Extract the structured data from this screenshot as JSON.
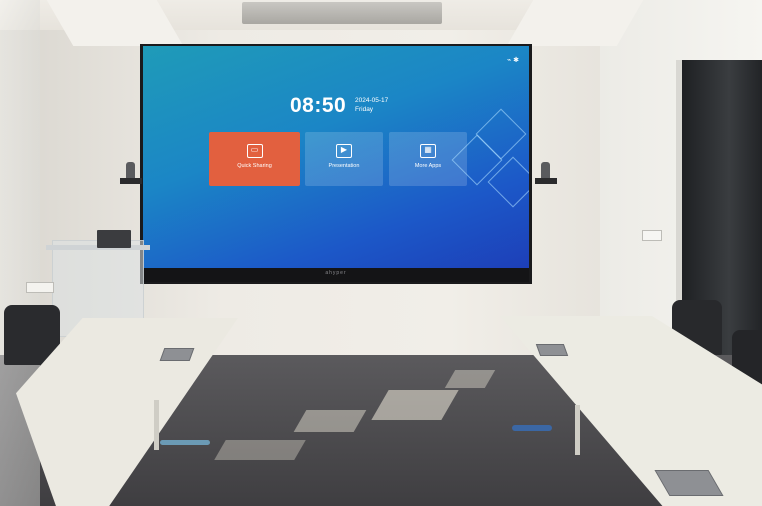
{
  "screen": {
    "status_icons": "⌁ ✱",
    "clock": "08:50",
    "date": "2024-05-17",
    "weekday": "Friday",
    "tiles": [
      {
        "label": "Quick Sharing",
        "icon": "▭",
        "color": "#e2603f"
      },
      {
        "label": "Presentation",
        "icon": "▶",
        "color": "#3a78c9"
      },
      {
        "label": "More Apps",
        "icon": "▦",
        "color": "#3a78c9"
      }
    ],
    "brand": "ahyper"
  }
}
